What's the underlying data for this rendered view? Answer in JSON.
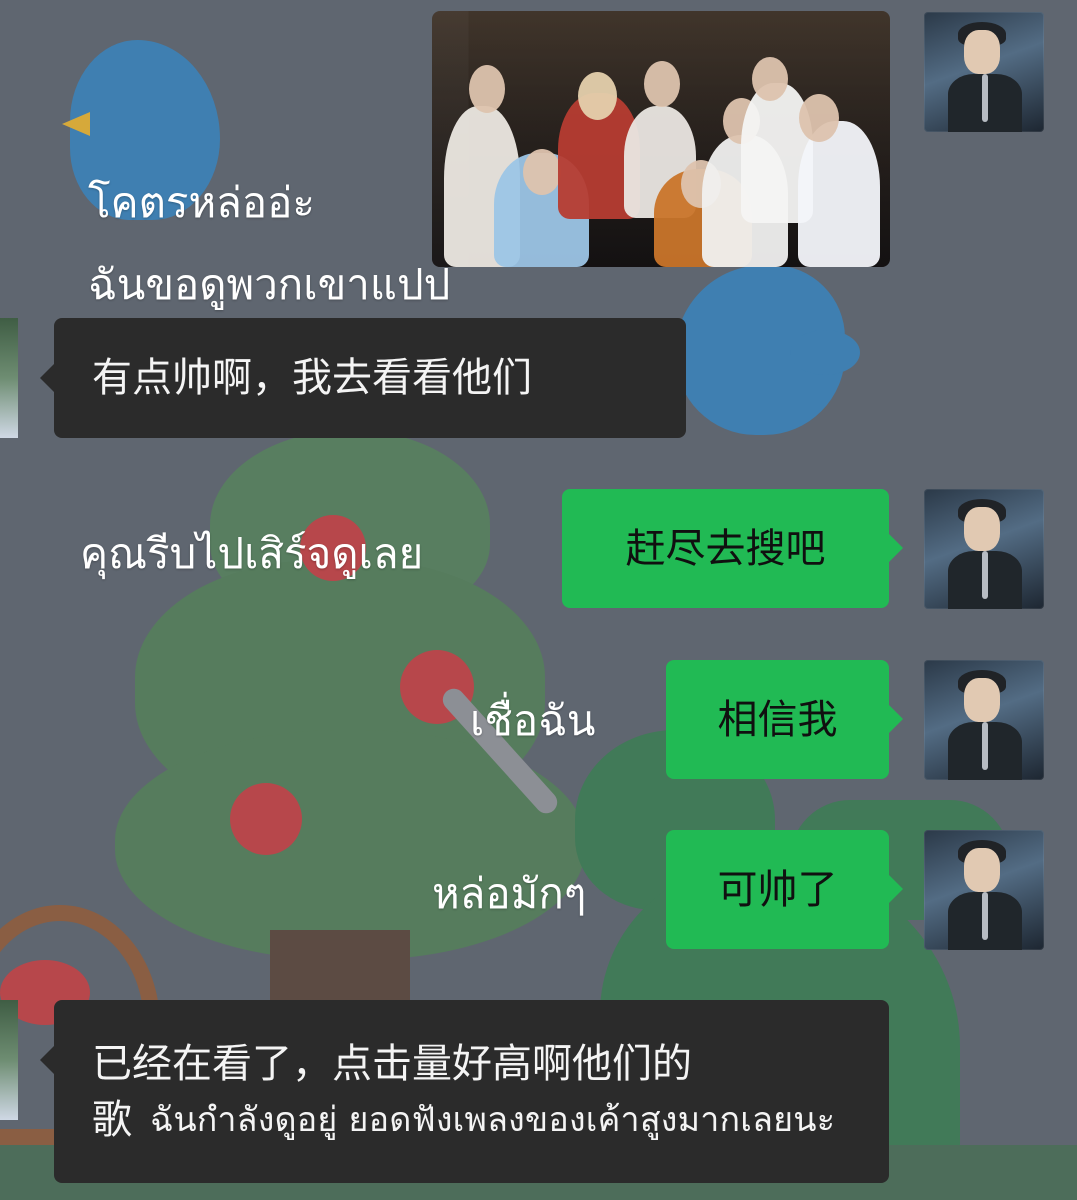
{
  "chat": {
    "messages": [
      {
        "side": "right",
        "type": "image",
        "caption": "โคตรหล่ออ่ะ\nฉันขอดูพวกเขาแปป"
      },
      {
        "side": "left",
        "type": "text",
        "text": "有点帅啊，我去看看他们"
      },
      {
        "side": "right",
        "type": "text",
        "text": "赶尽去搜吧",
        "translation": "คุณรีบไปเสิร์จดูเลย"
      },
      {
        "side": "right",
        "type": "text",
        "text": "相信我",
        "translation": "เชื่อฉัน"
      },
      {
        "side": "right",
        "type": "text",
        "text": "可帅了",
        "translation": "หล่อมักๆ"
      },
      {
        "side": "left",
        "type": "text",
        "text_line_1": "已经在看了，点击量好高啊他们的",
        "text_line_2": "歌",
        "translation_inline": "ฉันกำลังดูอยู่  ยอดฟังเพลงของเค้าสูงมากเลยนะ"
      }
    ]
  },
  "colors": {
    "wallpaper": "#5f6670",
    "dark_bubble": "#2b2b2b",
    "green_bubble": "#21ba54",
    "white_text": "#ffffff"
  },
  "icons": {
    "right_avatar": "singer-avatar",
    "left_avatar": "plant-avatar"
  }
}
